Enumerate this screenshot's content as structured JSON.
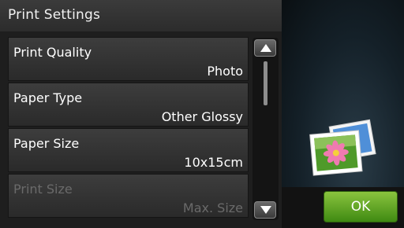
{
  "header": {
    "title": "Print Settings"
  },
  "settings": [
    {
      "label": "Print Quality",
      "value": "Photo",
      "enabled": true
    },
    {
      "label": "Paper Type",
      "value": "Other Glossy",
      "enabled": true
    },
    {
      "label": "Paper Size",
      "value": "10x15cm",
      "enabled": true
    },
    {
      "label": "Print Size",
      "value": "Max. Size",
      "enabled": false
    }
  ],
  "scroll": {
    "up_icon": "up-arrow",
    "down_icon": "down-arrow"
  },
  "preview": {
    "icon": "photo-icon"
  },
  "ok_button": {
    "label": "OK",
    "color": "#5aa822"
  }
}
